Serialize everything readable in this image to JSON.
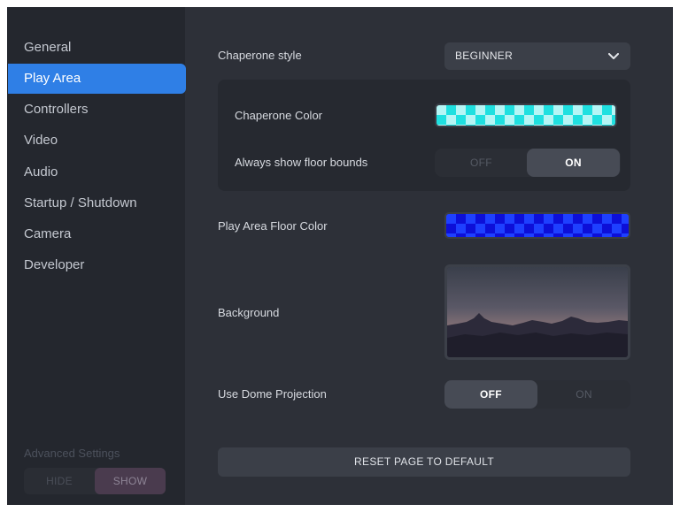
{
  "sidebar": {
    "items": [
      {
        "label": "General"
      },
      {
        "label": "Play Area",
        "active": true
      },
      {
        "label": "Controllers"
      },
      {
        "label": "Video"
      },
      {
        "label": "Audio"
      },
      {
        "label": "Startup / Shutdown"
      },
      {
        "label": "Camera"
      },
      {
        "label": "Developer"
      }
    ],
    "advanced": {
      "label": "Advanced Settings",
      "hide_label": "HIDE",
      "show_label": "SHOW",
      "selected": "SHOW"
    }
  },
  "main": {
    "chaperone_style": {
      "label": "Chaperone style",
      "value": "BEGINNER"
    },
    "chaperone_color": {
      "label": "Chaperone Color",
      "color": "#1fe0e0"
    },
    "floor_bounds": {
      "label": "Always show floor bounds",
      "off_label": "OFF",
      "on_label": "ON",
      "selected": "ON"
    },
    "floor_color": {
      "label": "Play Area Floor Color",
      "color": "#1e40ff"
    },
    "background": {
      "label": "Background"
    },
    "dome_projection": {
      "label": "Use Dome Projection",
      "off_label": "OFF",
      "on_label": "ON",
      "selected": "OFF"
    },
    "reset_label": "RESET PAGE TO DEFAULT"
  },
  "colors": {
    "accent": "#2f7fe6",
    "window_bg": "#2d3038",
    "sidebar_bg": "#24272e"
  }
}
